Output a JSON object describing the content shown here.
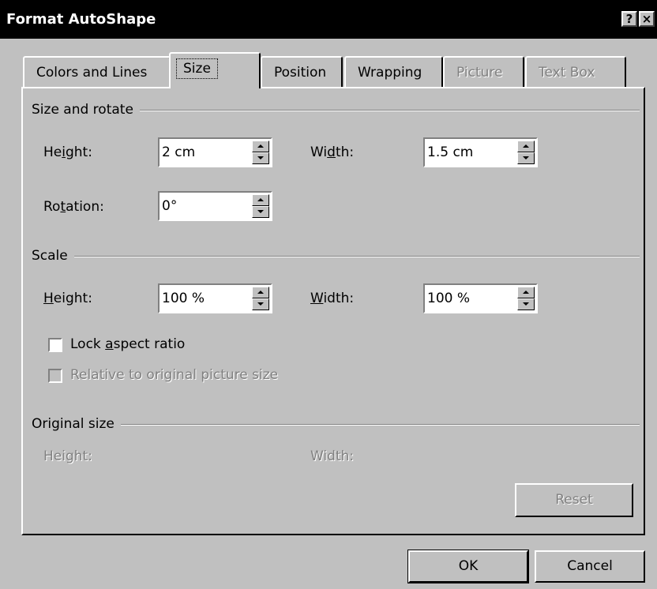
{
  "window": {
    "title": "Format AutoShape",
    "help_button": "?",
    "close_button": "×"
  },
  "tabs": [
    {
      "label": "Colors and Lines",
      "state": "normal"
    },
    {
      "label": "Size",
      "state": "active"
    },
    {
      "label": "Position",
      "state": "normal"
    },
    {
      "label": "Wrapping",
      "state": "normal"
    },
    {
      "label": "Picture",
      "state": "disabled"
    },
    {
      "label": "Text Box",
      "state": "disabled"
    }
  ],
  "size_rotate": {
    "title": "Size and rotate",
    "height_label_pre": "He",
    "height_label_u": "i",
    "height_label_post": "ght:",
    "height_value": "2 cm",
    "width_label_pre": "Wi",
    "width_label_u": "d",
    "width_label_post": "th:",
    "width_value": "1.5 cm",
    "rotation_label_pre": "Ro",
    "rotation_label_u": "t",
    "rotation_label_post": "ation:",
    "rotation_value": "0°"
  },
  "scale": {
    "title": "Scale",
    "height_label_u": "H",
    "height_label_post": "eight:",
    "height_value": "100 %",
    "width_label_u": "W",
    "width_label_post": "idth:",
    "width_value": "100 %",
    "lock_pre": "Lock ",
    "lock_u": "a",
    "lock_post": "spect ratio",
    "lock_checked": false,
    "relative_label": "Relative to original picture size",
    "relative_checked": false
  },
  "original_size": {
    "title": "Original size",
    "height_label": "Height:",
    "width_label": "Width:",
    "reset_label": "Reset"
  },
  "footer": {
    "ok_label": "OK",
    "cancel_label": "Cancel"
  }
}
